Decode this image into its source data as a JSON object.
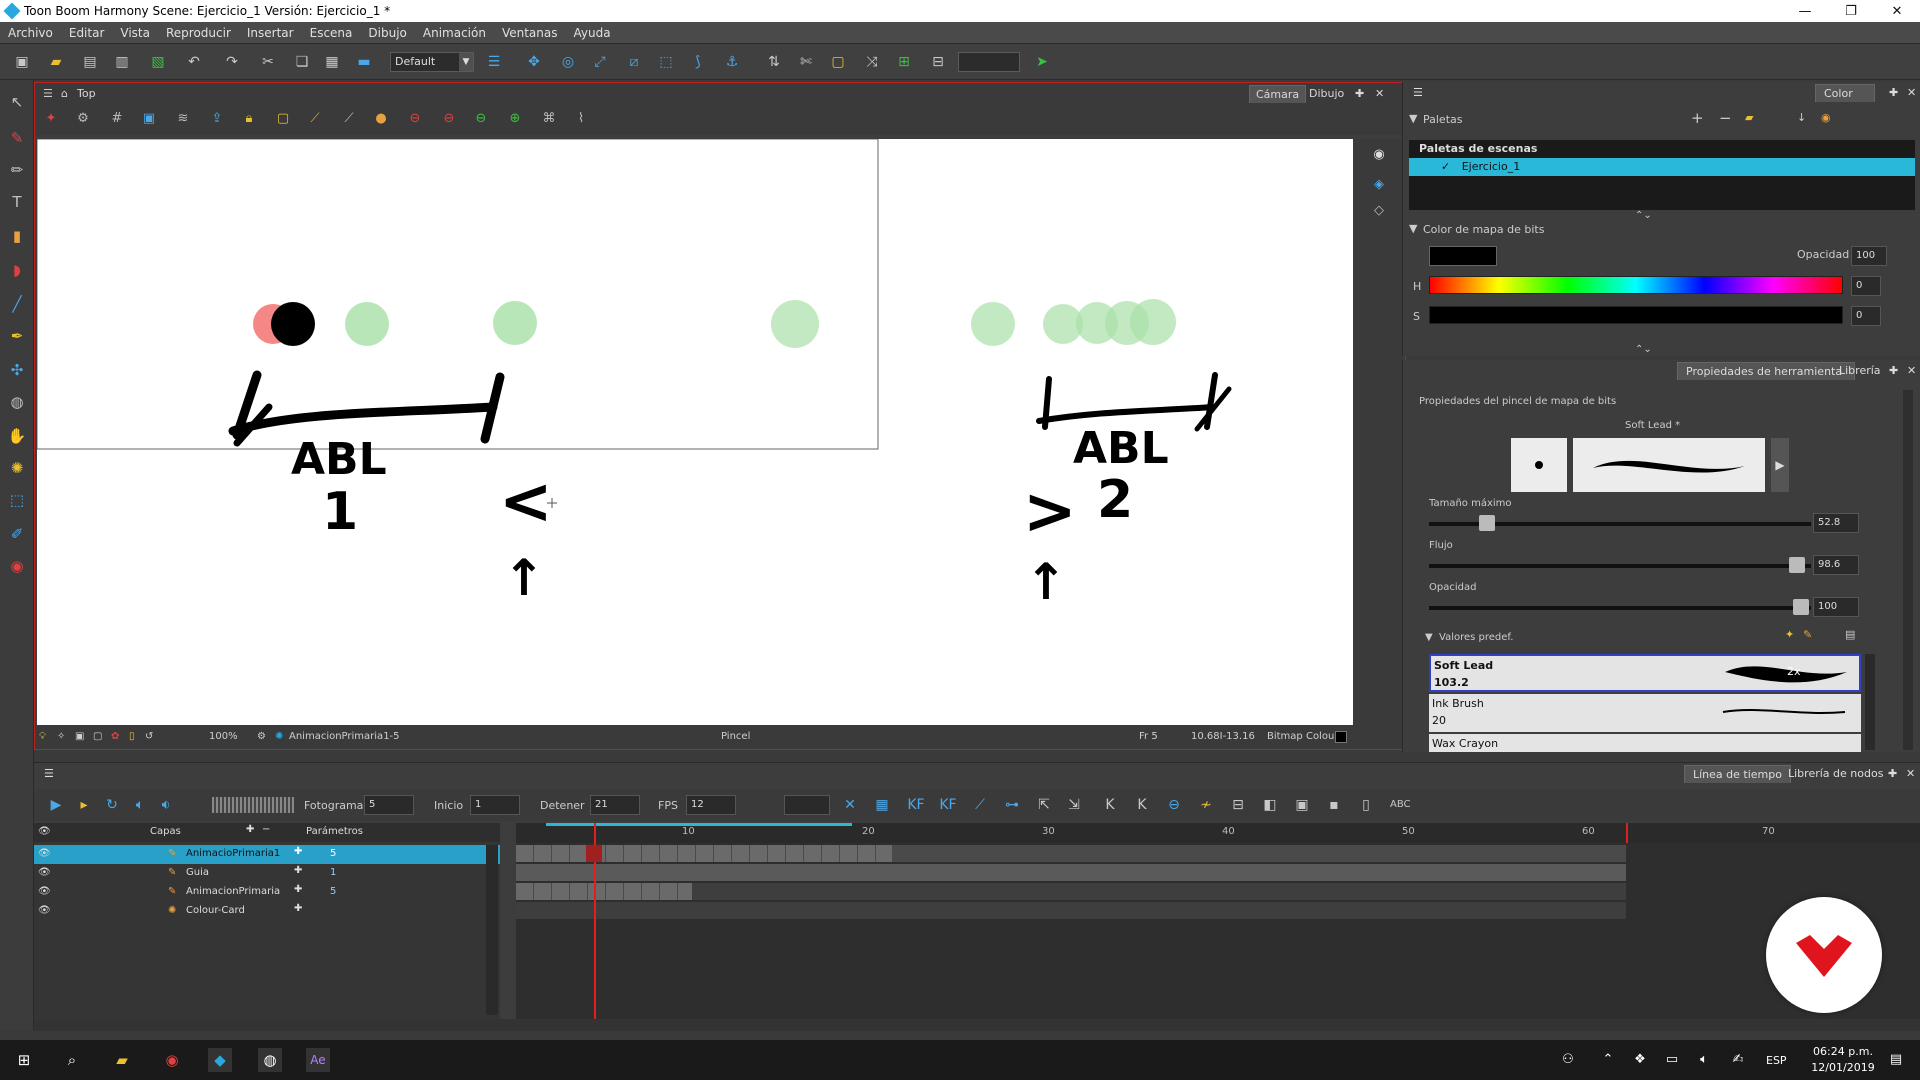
{
  "window": {
    "title": "Toon Boom Harmony Scene: Ejercicio_1 Versión: Ejercicio_1 *",
    "min": "—",
    "max": "❐",
    "close": "✕"
  },
  "menu": [
    "Archivo",
    "Editar",
    "Vista",
    "Reproducir",
    "Insertar",
    "Escena",
    "Dibujo",
    "Animación",
    "Ventanas",
    "Ayuda"
  ],
  "toolbar": {
    "workspace": "Default"
  },
  "view": {
    "title": "Top",
    "tabs": [
      "Cámara",
      "Dibujo"
    ],
    "status": {
      "zoom": "100%",
      "layer": "AnimacionPrimaria1-5",
      "tool": "Pincel",
      "frame": "Fr 5",
      "coords": "10.68I-13.16",
      "colour": "Bitmap Colour"
    }
  },
  "color_panel": {
    "tab": "Color",
    "palettes_label": "Paletas",
    "scene_palettes": "Paletas de escenas",
    "palette_item": "Ejercicio_1",
    "bitmap_color": "Color de mapa de bits",
    "opacity_label": "Opacidad",
    "opacity_value": "100",
    "h_label": "H",
    "h_value": "0",
    "s_label": "S",
    "s_value": "0",
    "swatch_color": "#000000"
  },
  "tool_props": {
    "tabs": [
      "Propiedades de herramienta",
      "Librería"
    ],
    "heading": "Propiedades del pincel de mapa de bits",
    "brush_name": "Soft Lead *",
    "max_size_label": "Tamaño máximo",
    "max_size_value": "52.8",
    "flow_label": "Flujo",
    "flow_value": "98.6",
    "opacity_label": "Opacidad",
    "opacity_value": "100",
    "presets_label": "Valores predef.",
    "presets": [
      {
        "name": "Soft Lead",
        "value": "103.2",
        "badge": "2x"
      },
      {
        "name": "Ink Brush",
        "value": "20"
      },
      {
        "name": "Wax Crayon",
        "value": ""
      }
    ]
  },
  "timeline": {
    "tabs": [
      "Línea de tiempo",
      "Librería de nodos"
    ],
    "frame_label": "Fotograma",
    "frame_value": "5",
    "start_label": "Inicio",
    "start_value": "1",
    "stop_label": "Detener",
    "stop_value": "21",
    "fps_label": "FPS",
    "fps_value": "12",
    "layers_header": "Capas",
    "params_header": "Parámetros",
    "ruler": [
      "10",
      "20",
      "30",
      "40",
      "50",
      "60",
      "70"
    ],
    "layers": [
      {
        "name": "AnimacioPrimaria1",
        "param": "5"
      },
      {
        "name": "Guia",
        "param": "1"
      },
      {
        "name": "AnimacionPrimaria",
        "param": "5"
      },
      {
        "name": "Colour-Card",
        "param": ""
      }
    ]
  },
  "taskbar": {
    "lang": "ESP",
    "time": "06:24 p.m.",
    "date": "12/01/2019"
  },
  "canvas_text": {
    "abl1": "ABL",
    "n1": "1",
    "abl2": "ABL",
    "n2": "2",
    "ease_in": "<",
    "ease_out": ">",
    "arrow1": "↑",
    "arrow2": "↑"
  }
}
